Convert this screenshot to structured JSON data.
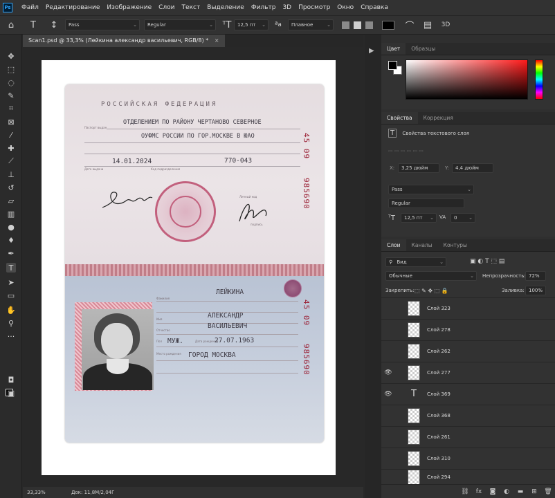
{
  "menubar": {
    "logo": "Ps",
    "items": [
      "Файл",
      "Редактирование",
      "Изображение",
      "Слои",
      "Текст",
      "Выделение",
      "Фильтр",
      "3D",
      "Просмотр",
      "Окно",
      "Справка"
    ]
  },
  "options": {
    "font_family": "Pass",
    "font_style": "Regular",
    "font_size": "12,5 пт",
    "antialias": "Плавное",
    "label_3d": "3D",
    "text_color": "#000000"
  },
  "document": {
    "tab_title": "Scan1.psd @ 33,3% (Лейкина александр васильевич, RGB/8) *",
    "zoom": "33,33%",
    "doc_size": "Док: 11,8M/2,04Г"
  },
  "passport": {
    "top": {
      "header": "РОССИЙСКАЯ ФЕДЕРАЦИЯ",
      "issued_by_label": "Паспорт выдан",
      "issued_by_line1": "ОТДЕЛЕНИЕМ ПО РАЙОНУ ЧЕРТАНОВО СЕВЕРНОЕ",
      "issued_by_line2": "ОУФМС РОССИИ ПО ГОР.МОСКВЕ В ЮАО",
      "issue_date": "14.01.2024",
      "issue_date_label": "Дата выдачи",
      "division_code": "770-043",
      "division_code_label": "Код подразделения",
      "personal_signature_label": "Личный код",
      "official_signature_label": "подпись",
      "serial_series": "45 09",
      "serial_number": "985690"
    },
    "bottom": {
      "surname_label": "Фамилия",
      "surname": "ЛЕЙКИНА",
      "name_label": "Имя",
      "name": "АЛЕКСАНДР",
      "patronymic_label": "Отчество",
      "patronymic": "ВАСИЛЬЕВИЧ",
      "sex_label": "Пол",
      "sex": "МУЖ.",
      "dob_label": "Дата рождения",
      "dob": "27.07.1963",
      "pob_label": "Место рождения",
      "pob": "ГОРОД МОСКВА",
      "serial_series": "45 09",
      "serial_number": "985690"
    }
  },
  "color_panel": {
    "tabs": [
      "Цвет",
      "Образцы"
    ]
  },
  "properties_panel": {
    "tabs": [
      "Свойства",
      "Коррекция"
    ],
    "title": "Свойства текстового слоя",
    "x_label": "X:",
    "x_value": "3,25 дюйм",
    "y_label": "Y:",
    "y_value": "4,4 дюйм",
    "font_family": "Pass",
    "font_style": "Regular",
    "font_size": "12,5 пт",
    "va_label": "VA",
    "tracking": "0"
  },
  "layers_panel": {
    "tabs": [
      "Слои",
      "Каналы",
      "Контуры"
    ],
    "filter_kind": "Вид",
    "blend_mode": "Обычные",
    "opacity_label": "Непрозрачность:",
    "opacity_value": "72%",
    "lock_label": "Закрепить:",
    "fill_label": "Заливка:",
    "fill_value": "100%",
    "layers": [
      {
        "name": "Слой 323",
        "visible": false,
        "type": "pixel"
      },
      {
        "name": "Слой 278",
        "visible": false,
        "type": "pixel"
      },
      {
        "name": "Слой 262",
        "visible": false,
        "type": "pixel"
      },
      {
        "name": "Слой 277",
        "visible": true,
        "type": "pixel"
      },
      {
        "name": "Слой 369",
        "visible": true,
        "type": "text"
      },
      {
        "name": "Слой 368",
        "visible": false,
        "type": "pixel"
      },
      {
        "name": "Слой 261",
        "visible": false,
        "type": "pixel"
      },
      {
        "name": "Слой 310",
        "visible": false,
        "type": "pixel"
      },
      {
        "name": "Слой 294",
        "visible": false,
        "type": "pixel"
      }
    ]
  }
}
